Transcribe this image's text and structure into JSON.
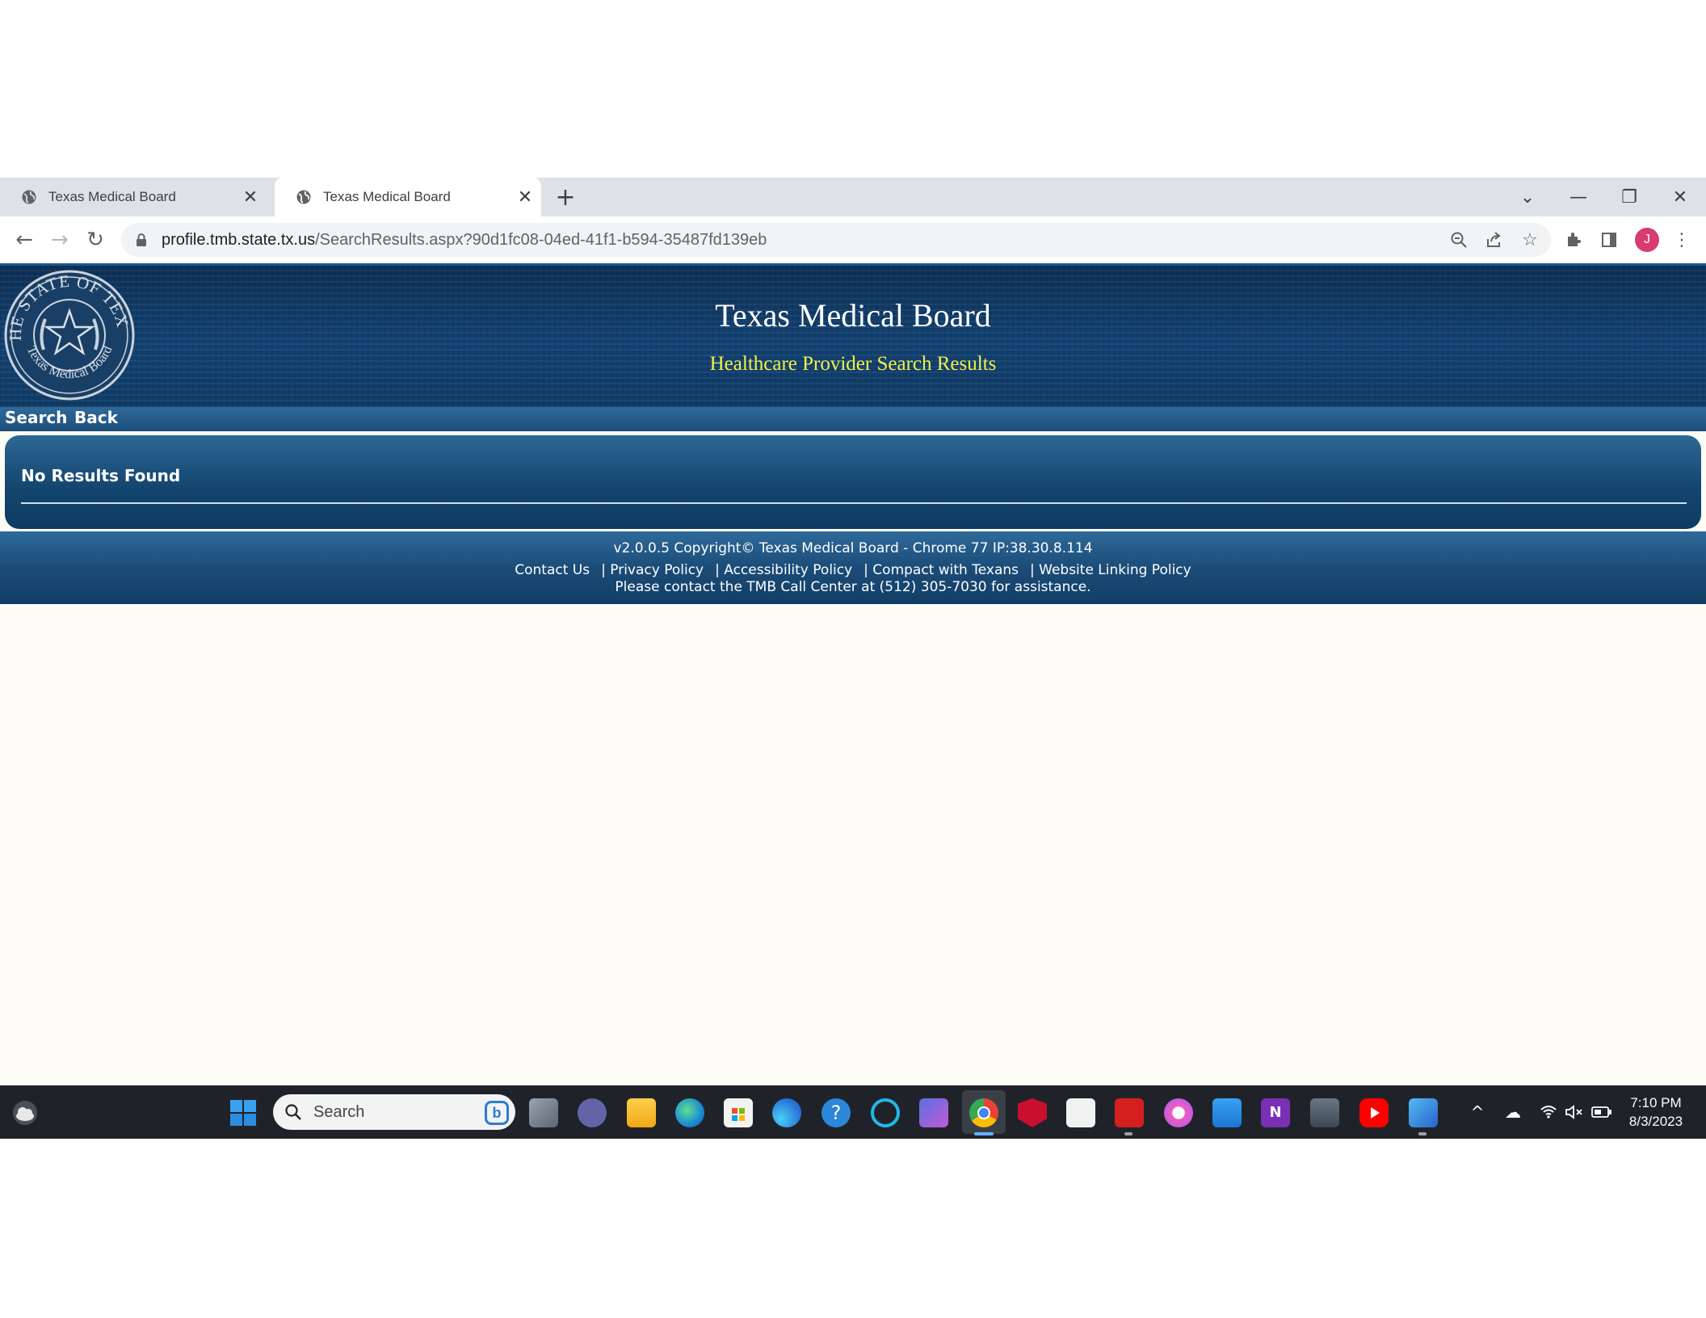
{
  "browser": {
    "tabs": [
      {
        "title": "Texas Medical Board",
        "active": false
      },
      {
        "title": "Texas Medical Board",
        "active": true
      }
    ],
    "url_host": "profile.tmb.state.tx.us",
    "url_path": "/SearchResults.aspx?90d1fc08-04ed-41f1-b594-35487fd139eb",
    "profile_initial": "J"
  },
  "site": {
    "title": "Texas Medical Board",
    "subtitle": "Healthcare Provider Search Results",
    "seal_text_top": "THE STATE OF TEXAS",
    "seal_text_bottom": "Texas Medical Board",
    "menu": [
      "Search",
      "Back"
    ],
    "results_message": "No Results Found",
    "footer": {
      "line1": "v2.0.0.5 Copyright© Texas Medical Board - Chrome 77 IP:38.30.8.114",
      "links": [
        "Contact Us",
        "| Privacy Policy",
        "| Accessibility Policy",
        "| Compact with Texans",
        "| Website Linking Policy"
      ],
      "line3": "Please contact the TMB Call Center at (512) 305-7030 for assistance."
    }
  },
  "colors": {
    "banner": "#124272",
    "subtitle": "#f4f04a",
    "accent_bar": "#1d4e7a"
  },
  "taskbar": {
    "search_placeholder": "Search",
    "time": "7:10 PM",
    "date": "8/3/2023",
    "apps": [
      "task-view",
      "teams-meet",
      "file-explorer",
      "edge",
      "microsoft-store",
      "edge-alt",
      "help",
      "alexa",
      "copilot-store",
      "chrome",
      "mcafee",
      "kindle",
      "acrobat",
      "itunes",
      "notepad",
      "onenote",
      "camera",
      "youtube",
      "photos"
    ]
  }
}
